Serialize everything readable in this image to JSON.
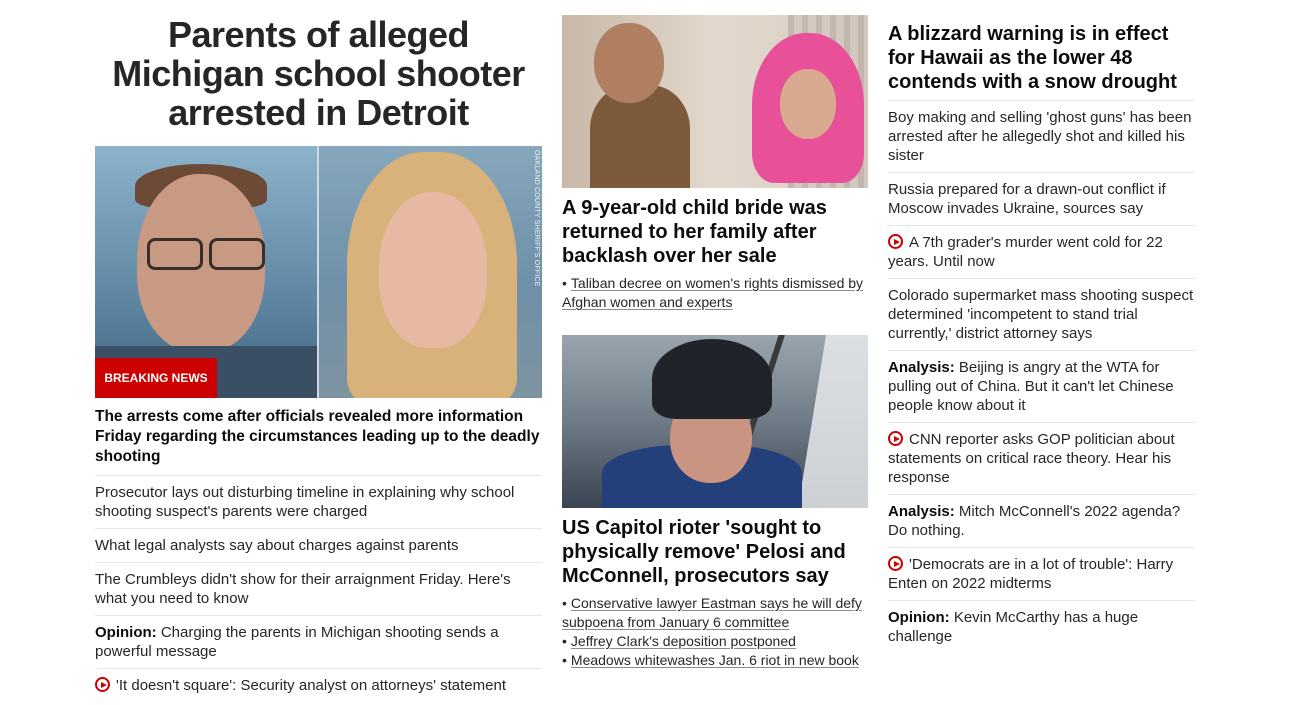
{
  "lead": {
    "headline": "Parents of alleged Michigan school shooter arrested in Detroit",
    "image_credit": "OAKLAND COUNTY SHERIFF'S OFFICE",
    "badge": "BREAKING NEWS",
    "summary": "The arrests come after officials revealed more information Friday regarding the circumstances leading up to the deadly shooting",
    "related": [
      {
        "prefix": "",
        "text": "Prosecutor lays out disturbing timeline in explaining why school shooting suspect's parents were charged",
        "video": false
      },
      {
        "prefix": "",
        "text": "What legal analysts say about charges against parents",
        "video": false
      },
      {
        "prefix": "",
        "text": "The Crumbleys didn't show for their arraignment Friday. Here's what you need to know",
        "video": false
      },
      {
        "prefix": "Opinion:",
        "text": " Charging the parents in Michigan shooting sends a powerful message",
        "video": false
      },
      {
        "prefix": "",
        "text": "'It doesn't square': Security analyst on attorneys' statement",
        "video": true
      }
    ]
  },
  "middle": {
    "story1": {
      "headline": "A 9-year-old child bride was returned to her family after backlash over her sale",
      "links": [
        "Taliban decree on women's rights dismissed by Afghan women and experts"
      ]
    },
    "story2": {
      "headline": "US Capitol rioter 'sought to physically remove' Pelosi and McConnell, prosecutors say",
      "links": [
        "Conservative lawyer Eastman says he will defy subpoena from January 6 committee",
        "Jeffrey Clark's deposition postponed",
        "Meadows whitewashes Jan. 6 riot in new book"
      ]
    }
  },
  "right": {
    "headline": "A blizzard warning is in effect for Hawaii as the lower 48 contends with a snow drought",
    "items": [
      {
        "prefix": "",
        "text": "Boy making and selling 'ghost guns' has been arrested after he allegedly shot and killed his sister",
        "video": false
      },
      {
        "prefix": "",
        "text": "Russia prepared for a drawn-out conflict if Moscow invades Ukraine, sources say",
        "video": false
      },
      {
        "prefix": "",
        "text": "A 7th grader's murder went cold for 22 years. Until now",
        "video": true
      },
      {
        "prefix": "",
        "text": "Colorado supermarket mass shooting suspect determined 'incompetent to stand trial currently,' district attorney says",
        "video": false
      },
      {
        "prefix": "Analysis:",
        "text": " Beijing is angry at the WTA for pulling out of China. But it can't let Chinese people know about it",
        "video": false
      },
      {
        "prefix": "",
        "text": "CNN reporter asks GOP politician about statements on critical race theory. Hear his response",
        "video": true
      },
      {
        "prefix": "Analysis:",
        "text": " Mitch McConnell's 2022 agenda? Do nothing.",
        "video": false
      },
      {
        "prefix": "",
        "text": "'Democrats are in a lot of trouble': Harry Enten on 2022 midterms",
        "video": true
      },
      {
        "prefix": "Opinion:",
        "text": " Kevin McCarthy has a huge challenge",
        "video": false
      }
    ]
  },
  "colors": {
    "accent": "#cc0000",
    "text": "#0c0c0c",
    "divider": "#e6e6e6"
  }
}
